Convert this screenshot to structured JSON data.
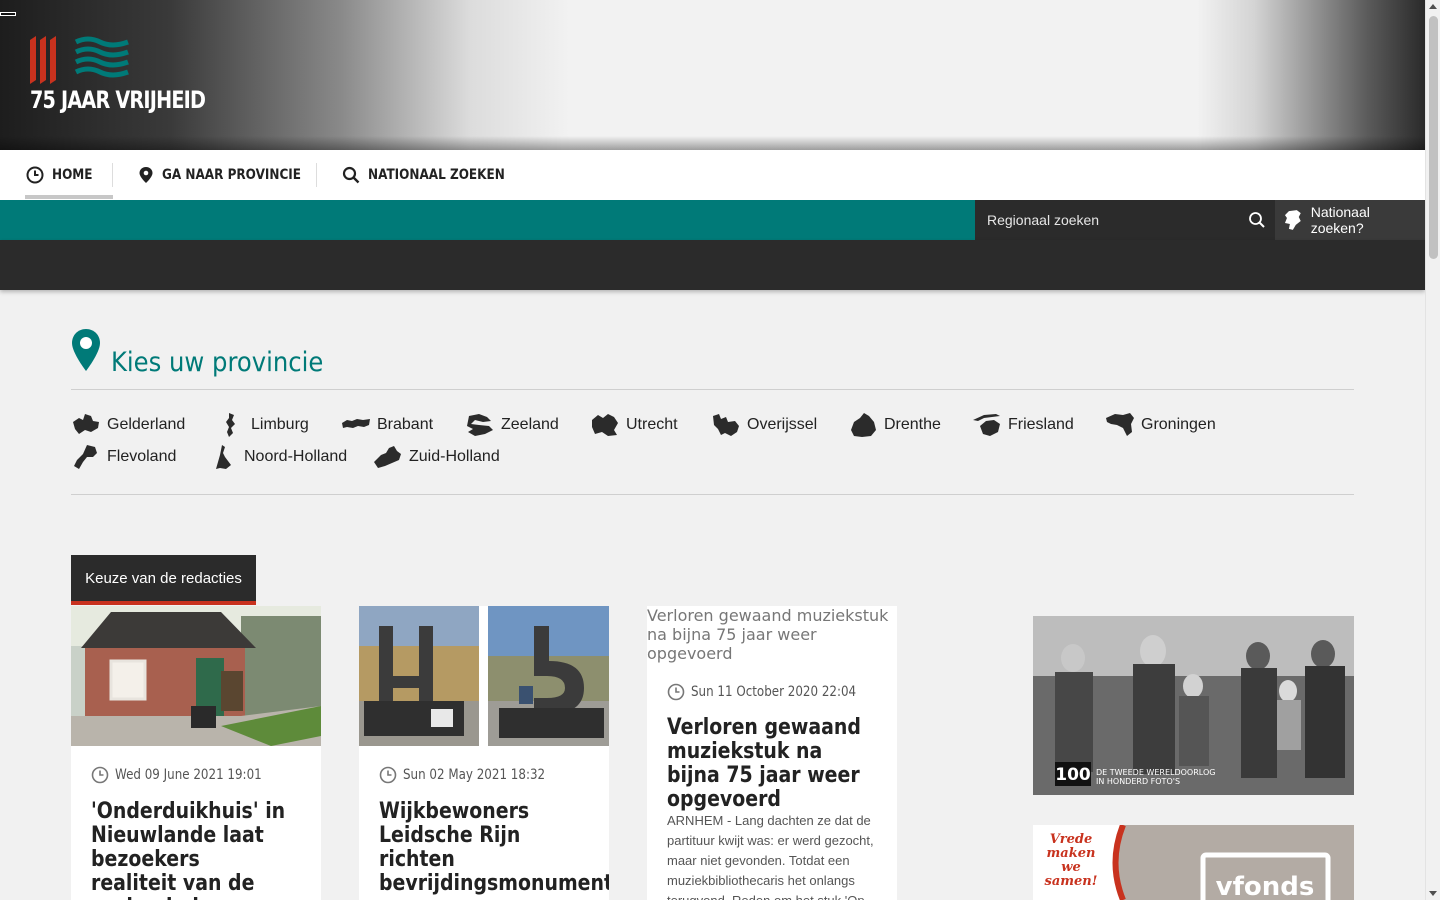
{
  "brand": {
    "logo_text": "75 JAAR VRIJHEID"
  },
  "nav": {
    "home": "HOME",
    "province": "GA NAAR PROVINCIE",
    "national": "NATIONAAL ZOEKEN"
  },
  "search": {
    "placeholder": "Regionaal zoeken",
    "national_label": "Nationaal zoeken?"
  },
  "provinces": {
    "title": "Kies uw provincie",
    "items": [
      "Gelderland",
      "Limburg",
      "Brabant",
      "Zeeland",
      "Utrecht",
      "Overijssel",
      "Drenthe",
      "Friesland",
      "Groningen",
      "Flevoland",
      "Noord-Holland",
      "Zuid-Holland"
    ]
  },
  "editors": {
    "tab_label": "Keuze van de redacties",
    "cards": [
      {
        "date": "Wed 09 June 2021 19:01",
        "title": "'Onderduikhuis' in Nieuwlande laat bezoekers realiteit van de oorlog beleven"
      },
      {
        "date": "Sun 02 May 2021 18:32",
        "title": "Wijkbewoners Leidsche Rijn richten bevrijdingsmonument op"
      },
      {
        "image_alt": "Verloren gewaand muziekstuk na bijna 75 jaar weer opgevoerd",
        "date": "Sun 11 October 2020 22:04",
        "title": "Verloren gewaand muziekstuk na bijna 75 jaar weer opgevoerd",
        "excerpt": "ARNHEM - Lang dachten ze dat de partituur kwijt was: er werd gezocht, maar niet gevonden. Totdat een muziekbibliothecaris het onlangs terugvond. Reden om het stuk 'Op het"
      }
    ]
  },
  "ads": {
    "ad1_caption_top": "DE TWEEDE WERELDOORLOG",
    "ad1_caption_bottom": "IN HONDERD FOTO'S",
    "ad1_logo": "100",
    "ad2_slogan": "Vrede maken we samen!",
    "ad2_brand": "vfonds"
  },
  "colors": {
    "teal": "#007a78",
    "dark": "#2b2b2b",
    "accent_red": "#c8321e"
  }
}
